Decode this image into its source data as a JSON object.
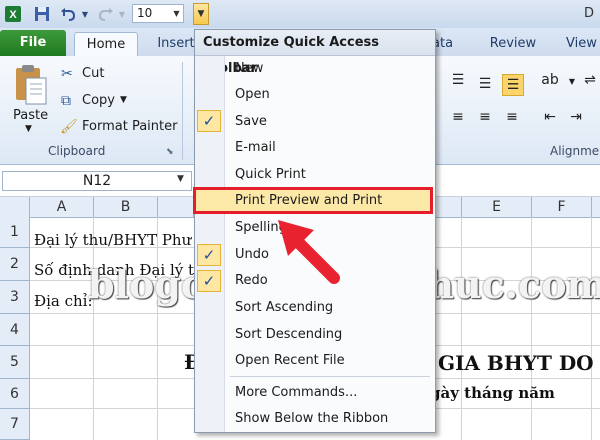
{
  "qat": {
    "font_size": "10",
    "titlebar_right": "D",
    "icons": [
      "excel-logo-icon",
      "save-icon",
      "undo-icon",
      "undo-dropdown-icon",
      "redo-icon",
      "redo-dropdown-icon",
      "font-size-dropdown-icon",
      "customize-qat-dropdown-icon"
    ]
  },
  "tabs": {
    "file": "File",
    "home": "Home",
    "insert": "Insert",
    "data": "Data",
    "review": "Review",
    "view": "View"
  },
  "ribbon": {
    "clipboard": {
      "paste": "Paste",
      "cut": "Cut",
      "copy": "Copy",
      "format_painter": "Format Painter",
      "group_label": "Clipboard"
    },
    "alignment": {
      "group_label": "Alignme"
    }
  },
  "namebox": {
    "value": "N12"
  },
  "grid": {
    "columns": [
      "A",
      "B",
      "E",
      "F"
    ],
    "rows": [
      "1",
      "2",
      "3",
      "4",
      "5",
      "6",
      "7"
    ],
    "cells": {
      "r1": "Đại lý thu/BHYT Phư",
      "r2": "Số định danh Đại lý th",
      "r3": "Địa chỉ:",
      "r5_left": "Đ",
      "r5_right": "GIA BHYT DO ",
      "r6": "gày      tháng      năm"
    }
  },
  "watermark": "blogchiasekienthuc.com",
  "menu": {
    "title": "Customize Quick Access Toolbar",
    "items": [
      {
        "label": "New",
        "checked": false
      },
      {
        "label": "Open",
        "checked": false
      },
      {
        "label": "Save",
        "checked": true
      },
      {
        "label": "E-mail",
        "checked": false
      },
      {
        "label": "Quick Print",
        "checked": false
      },
      {
        "label": "Print Preview and Print",
        "checked": false,
        "highlighted": true
      },
      {
        "label": "Spelling",
        "checked": false
      },
      {
        "label": "Undo",
        "checked": true
      },
      {
        "label": "Redo",
        "checked": true
      },
      {
        "label": "Sort Ascending",
        "checked": false
      },
      {
        "label": "Sort Descending",
        "checked": false
      },
      {
        "label": "Open Recent File",
        "checked": false
      },
      {
        "label": "More Commands...",
        "checked": false
      },
      {
        "label": "Show Below the Ribbon",
        "checked": false
      }
    ]
  },
  "colors": {
    "highlight_border": "#e41f2b",
    "arrow": "#e8232f",
    "file_tab": "#2a8a2a",
    "hover": "#fce9a8"
  }
}
